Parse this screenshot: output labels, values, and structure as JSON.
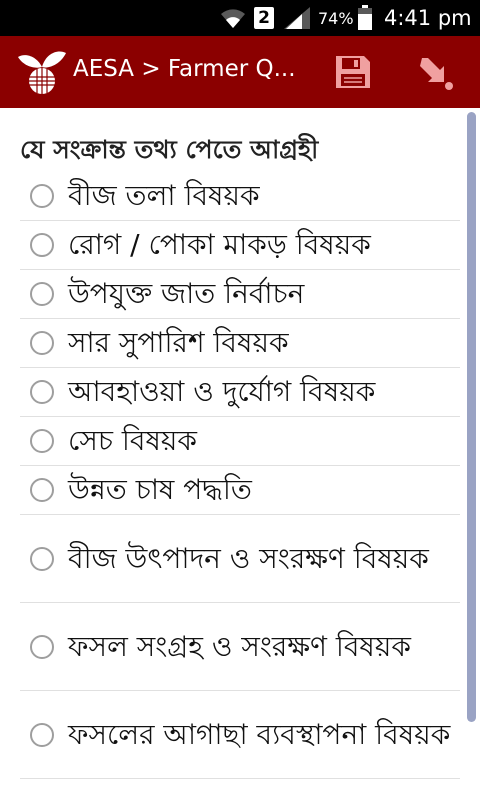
{
  "status_bar": {
    "sim_slot": "2",
    "battery_percent": "74%",
    "time": "4:41 pm"
  },
  "action_bar": {
    "title": "AESA > Farmer Q...",
    "colors": {
      "background": "#8b0000",
      "icon": "#f0a0a0"
    }
  },
  "form": {
    "question": "যে সংক্রান্ত তথ্য পেতে আগ্রহী",
    "options": [
      "বীজ তলা বিষয়ক",
      "রোগ / পোকা মাকড় বিষয়ক",
      "উপযুক্ত জাত নির্বাচন",
      "সার সুপারিশ বিষয়ক",
      "আবহাওয়া ও দুর্যোগ বিষয়ক",
      "সেচ বিষয়ক",
      "উন্নত চাষ পদ্ধতি",
      "বীজ উৎপাদন ও সংরক্ষণ বিষয়ক",
      "ফসল সংগ্রহ ও সংরক্ষণ বিষয়ক",
      "ফসলের আগাছা ব্যবস্থাপনা বিষয়ক"
    ]
  }
}
